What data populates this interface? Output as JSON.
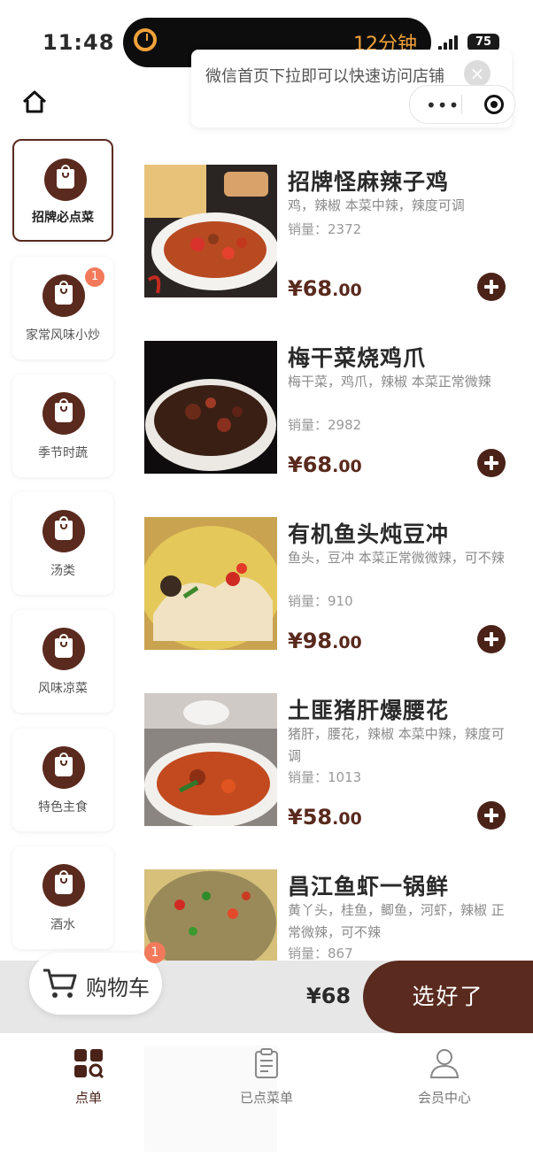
{
  "status_bar": {
    "time": "11:48",
    "timer": "12分钟",
    "battery": "75"
  },
  "popup": {
    "text": "微信首页下拉即可以快速访问店铺",
    "close": "×",
    "menu": "•••"
  },
  "sidebar": {
    "items": [
      {
        "label": "招牌必点菜",
        "active": true,
        "badge": ""
      },
      {
        "label": "家常风味小炒",
        "active": false,
        "badge": "1"
      },
      {
        "label": "季节时蔬",
        "active": false,
        "badge": ""
      },
      {
        "label": "汤类",
        "active": false,
        "badge": ""
      },
      {
        "label": "风味凉菜",
        "active": false,
        "badge": ""
      },
      {
        "label": "特色主食",
        "active": false,
        "badge": ""
      },
      {
        "label": "酒水",
        "active": false,
        "badge": ""
      }
    ]
  },
  "dishes": [
    {
      "name": "招牌怪麻辣子鸡",
      "desc": "鸡，辣椒 本菜中辣，辣度可调",
      "sales": "销量：2372",
      "price": "¥68",
      "cents": ".00"
    },
    {
      "name": "梅干菜烧鸡爪",
      "desc": "梅干菜，鸡爪，辣椒 本菜正常微辣",
      "sales": "销量：2982",
      "price": "¥68",
      "cents": ".00"
    },
    {
      "name": "有机鱼头炖豆冲",
      "desc": "鱼头，豆冲 本菜正常微微辣，可不辣",
      "sales": "销量：910",
      "price": "¥98",
      "cents": ".00"
    },
    {
      "name": "土匪猪肝爆腰花",
      "desc": "猪肝，腰花，辣椒 本菜中辣，辣度可调",
      "sales": "销量：1013",
      "price": "¥58",
      "cents": ".00"
    },
    {
      "name": "昌江鱼虾一锅鲜",
      "desc": "黄丫头，桂鱼，鲫鱼，河虾，辣椒 正常微辣，可不辣",
      "sales": "销量：867",
      "price": "",
      "cents": ""
    }
  ],
  "cart": {
    "label": "购物车",
    "badge": "1",
    "total": "¥68",
    "checkout": "选好了"
  },
  "tabs": [
    {
      "label": "点单",
      "active": true
    },
    {
      "label": "已点菜单",
      "active": false
    },
    {
      "label": "会员中心",
      "active": false
    }
  ],
  "colors": {
    "brand": "#5a2a1e",
    "badge": "#f27a5a",
    "timer": "#f0a23a"
  }
}
